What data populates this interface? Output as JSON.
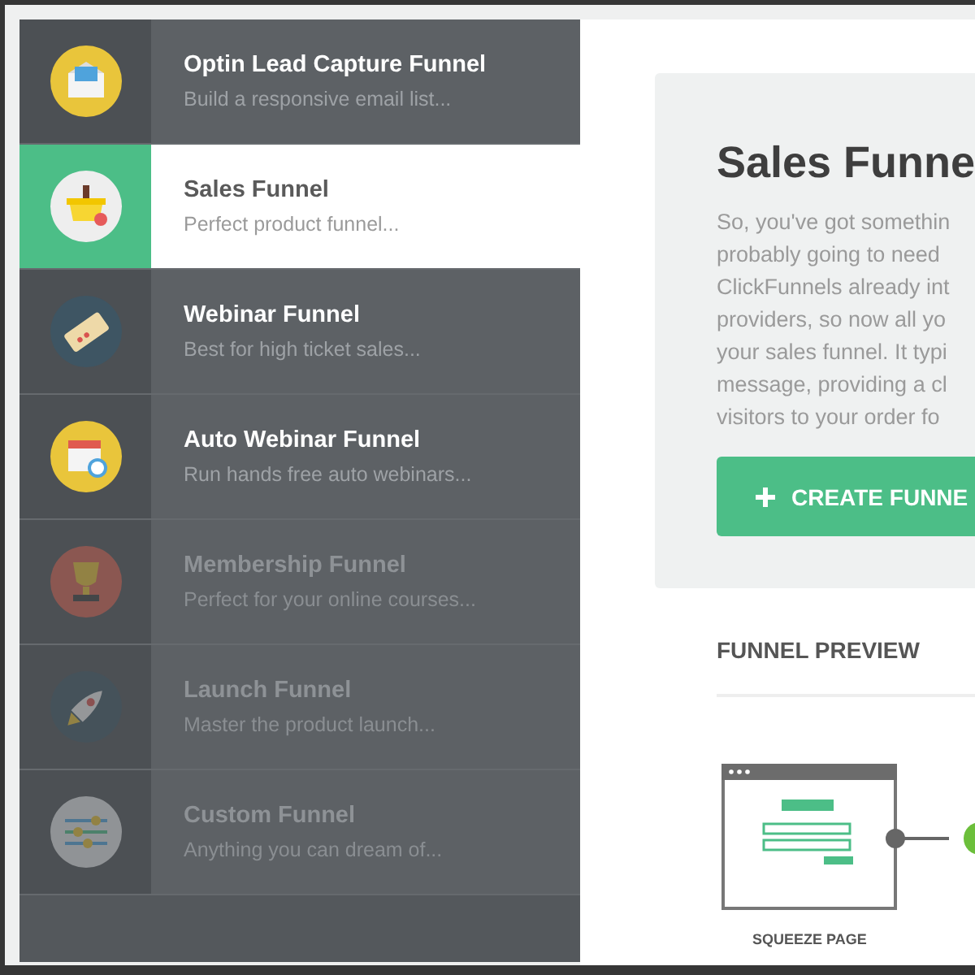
{
  "funnels": [
    {
      "kind": "envelope",
      "title": "Optin Lead Capture Funnel",
      "subtitle": "Build a responsive email list...",
      "selected": false,
      "disabled": false
    },
    {
      "kind": "basket",
      "title": "Sales Funnel",
      "subtitle": "Perfect product funnel...",
      "selected": true,
      "disabled": false
    },
    {
      "kind": "ticket",
      "title": "Webinar Funnel",
      "subtitle": "Best for high ticket sales...",
      "selected": false,
      "disabled": false
    },
    {
      "kind": "calendar",
      "title": "Auto Webinar Funnel",
      "subtitle": "Run hands free auto webinars...",
      "selected": false,
      "disabled": false
    },
    {
      "kind": "trophy",
      "title": "Membership Funnel",
      "subtitle": "Perfect for your online courses...",
      "selected": false,
      "disabled": true
    },
    {
      "kind": "rocket",
      "title": "Launch Funnel",
      "subtitle": "Master the product launch...",
      "selected": false,
      "disabled": true
    },
    {
      "kind": "sliders",
      "title": "Custom Funnel",
      "subtitle": "Anything you can dream of...",
      "selected": false,
      "disabled": true
    }
  ],
  "detail": {
    "title": "Sales Funne",
    "description_lines": [
      "So, you've got somethin",
      "probably going to need",
      "ClickFunnels already int",
      "providers, so now all yo",
      "your sales funnel. It typi",
      "message, providing a cl",
      "visitors to your order fo"
    ],
    "button": "CREATE FUNNE"
  },
  "preview": {
    "heading": "FUNNEL PREVIEW",
    "steps": [
      {
        "label": "SQUEEZE PAGE"
      }
    ]
  }
}
